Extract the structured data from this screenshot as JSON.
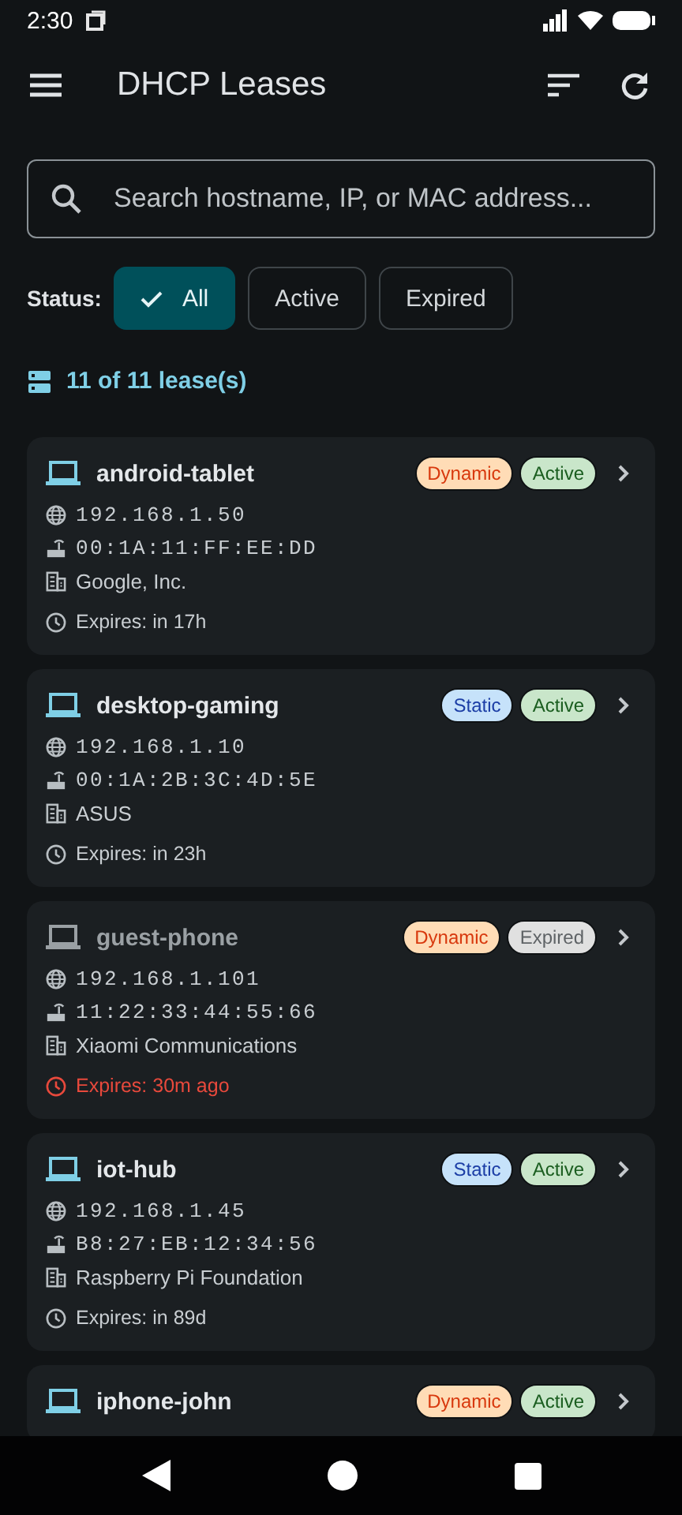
{
  "status_bar": {
    "time": "2:30"
  },
  "app_bar": {
    "title": "DHCP Leases"
  },
  "search": {
    "placeholder": "Search hostname, IP, or MAC address..."
  },
  "filter": {
    "label": "Status:",
    "chips": [
      {
        "label": "All",
        "selected": true
      },
      {
        "label": "Active",
        "selected": false
      },
      {
        "label": "Expired",
        "selected": false
      }
    ]
  },
  "count": "11 of 11 lease(s)",
  "leases": [
    {
      "hostname": "android-tablet",
      "expired": false,
      "type_badge": {
        "label": "Dynamic",
        "kind": "dynamic"
      },
      "status_badge": {
        "label": "Active",
        "kind": "active"
      },
      "ip": "192.168.1.50",
      "mac": "00:1A:11:FF:EE:DD",
      "vendor": "Google, Inc.",
      "expires": "Expires: in 17h"
    },
    {
      "hostname": "desktop-gaming",
      "expired": false,
      "type_badge": {
        "label": "Static",
        "kind": "static"
      },
      "status_badge": {
        "label": "Active",
        "kind": "active"
      },
      "ip": "192.168.1.10",
      "mac": "00:1A:2B:3C:4D:5E",
      "vendor": "ASUS",
      "expires": "Expires: in 23h"
    },
    {
      "hostname": "guest-phone",
      "expired": true,
      "type_badge": {
        "label": "Dynamic",
        "kind": "dynamic"
      },
      "status_badge": {
        "label": "Expired",
        "kind": "expired"
      },
      "ip": "192.168.1.101",
      "mac": "11:22:33:44:55:66",
      "vendor": "Xiaomi Communications",
      "expires": "Expires: 30m ago"
    },
    {
      "hostname": "iot-hub",
      "expired": false,
      "type_badge": {
        "label": "Static",
        "kind": "static"
      },
      "status_badge": {
        "label": "Active",
        "kind": "active"
      },
      "ip": "192.168.1.45",
      "mac": "B8:27:EB:12:34:56",
      "vendor": "Raspberry Pi Foundation",
      "expires": "Expires: in 89d"
    },
    {
      "hostname": "iphone-john",
      "expired": false,
      "type_badge": {
        "label": "Dynamic",
        "kind": "dynamic"
      },
      "status_badge": {
        "label": "Active",
        "kind": "active"
      }
    }
  ]
}
